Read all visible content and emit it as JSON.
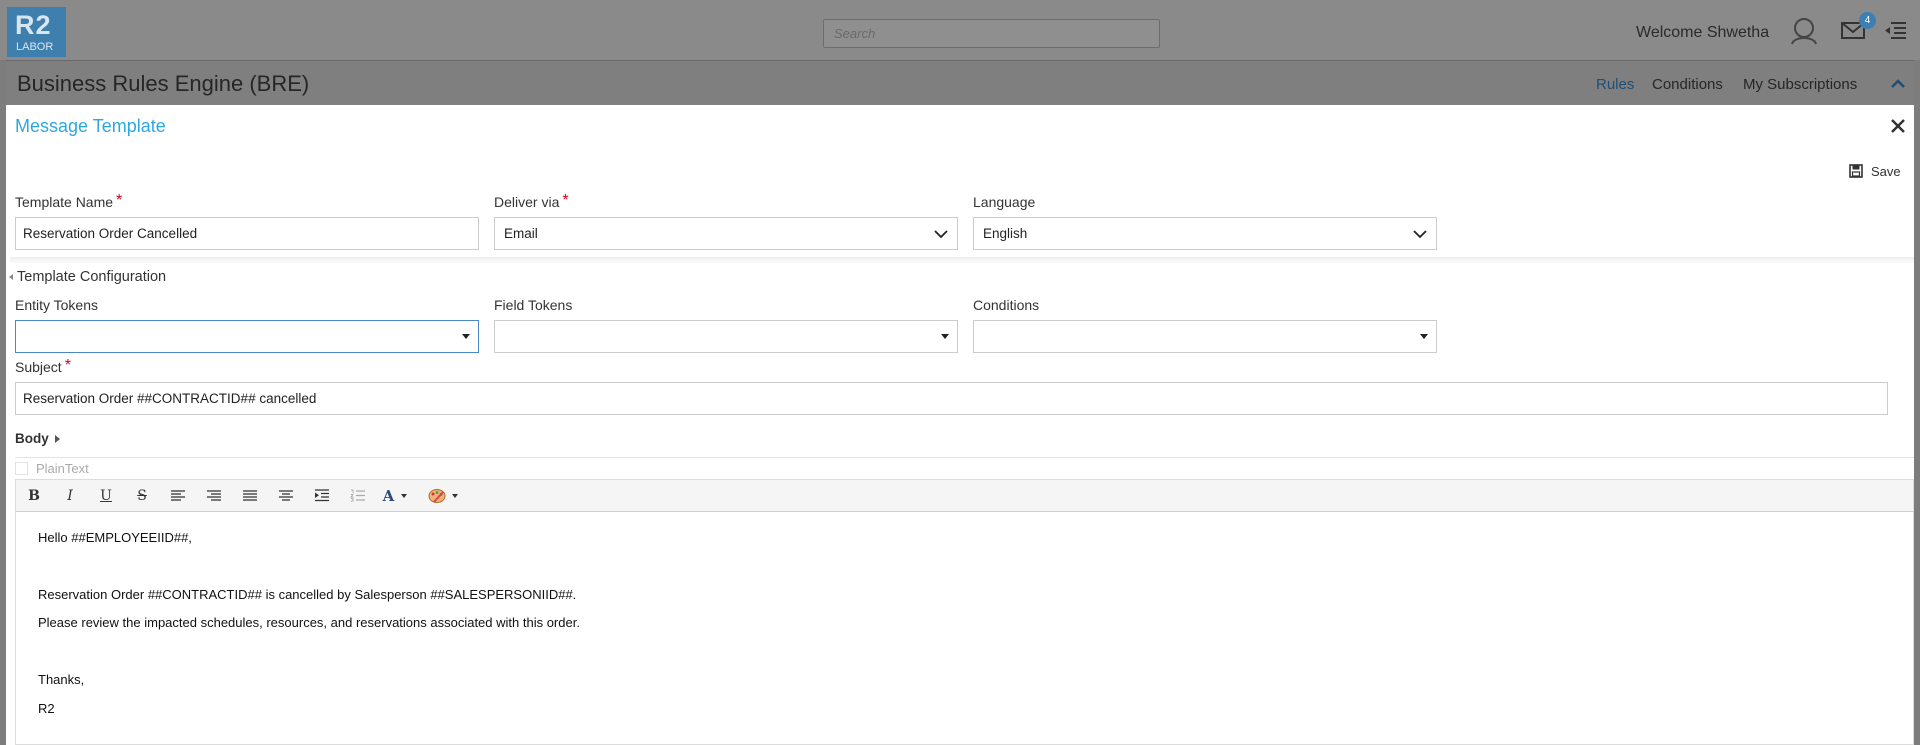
{
  "header": {
    "logo_big": "R2",
    "logo_small": "LABOR",
    "search_placeholder": "Search",
    "welcome": "Welcome Shwetha",
    "mail_count": "4"
  },
  "subheader": {
    "title": "Business Rules Engine (BRE)",
    "nav": {
      "rules": "Rules",
      "conditions": "Conditions",
      "subscriptions": "My Subscriptions"
    }
  },
  "modal": {
    "title": "Message Template",
    "save_label": "Save",
    "template_name": {
      "label": "Template Name",
      "value": "Reservation Order Cancelled"
    },
    "deliver_via": {
      "label": "Deliver via",
      "value": "Email"
    },
    "language": {
      "label": "Language",
      "value": "English"
    },
    "config_title": "Template Configuration",
    "entity_tokens": {
      "label": "Entity Tokens",
      "value": ""
    },
    "field_tokens": {
      "label": "Field Tokens",
      "value": ""
    },
    "conditions": {
      "label": "Conditions",
      "value": ""
    },
    "subject": {
      "label": "Subject",
      "value": "Reservation Order ##CONTRACTID## cancelled"
    },
    "body_label": "Body",
    "plaintext_label": "PlainText",
    "toolbar": {
      "bold": "B",
      "italic": "I",
      "underline": "U",
      "strike": "S",
      "font_color": "A"
    },
    "body_lines": [
      "Hello ##EMPLOYEEIID##,",
      "Reservation Order ##CONTRACTID## is cancelled by Salesperson ##SALESPERSONIID##.",
      "Please review the impacted schedules, resources, and reservations associated with this order.",
      "Thanks,",
      "R2"
    ]
  },
  "colors": {
    "accent": "#2ea7e0",
    "logo_bg": "#3e7fae",
    "required": "#d0021b",
    "overlay": "#7d7d7d"
  }
}
